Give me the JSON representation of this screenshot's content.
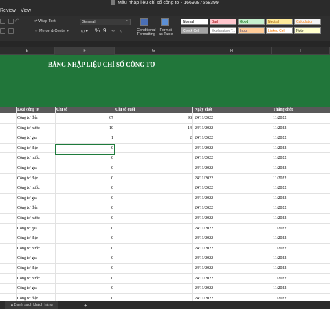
{
  "window": {
    "title": "Mẫu nhập liệu chỉ số công tơ - 1669287558399"
  },
  "menu": {
    "items": [
      "Review",
      "View"
    ]
  },
  "ribbon": {
    "wrap_text": "Wrap Text",
    "merge_center": "Merge & Center",
    "number_format": "General",
    "percent": "%",
    "comma": "9",
    "conditional_formatting": [
      "Conditional",
      "Formatting"
    ],
    "format_as_table": [
      "Format",
      "as Table"
    ],
    "styles": [
      {
        "label": "Normal",
        "bg": "#ffffff",
        "fg": "#000000"
      },
      {
        "label": "Bad",
        "bg": "#ffc7ce",
        "fg": "#9c0006"
      },
      {
        "label": "Good",
        "bg": "#c6efce",
        "fg": "#006100"
      },
      {
        "label": "Neutral",
        "bg": "#ffeb9c",
        "fg": "#9c5700"
      },
      {
        "label": "Calculation",
        "bg": "#f2f2f2",
        "fg": "#fa7d00"
      },
      {
        "label": "Check Cell",
        "bg": "#a5a5a5",
        "fg": "#ffffff"
      },
      {
        "label": "Explanatory T...",
        "bg": "#ffffff",
        "fg": "#7f7f7f"
      },
      {
        "label": "Input",
        "bg": "#ffcc99",
        "fg": "#3f3f76"
      },
      {
        "label": "Linked Cell",
        "bg": "#ffffff",
        "fg": "#fa7d00"
      },
      {
        "label": "Note",
        "bg": "#ffffcc",
        "fg": "#000000"
      }
    ]
  },
  "columns": [
    "E",
    "F",
    "G",
    "H",
    "I"
  ],
  "banner": {
    "title": "BẢNG NHẬP LIỆU CHỈ SỐ CÔNG TƠ"
  },
  "table": {
    "headers": [
      "Loại công tơ",
      "Chỉ số",
      "Chỉ số cuối",
      "Ngày chốt",
      "Tháng chốt"
    ],
    "rows": [
      [
        "Công tơ điện",
        "67",
        "98",
        "24/11/2022",
        "11/2022"
      ],
      [
        "Công tơ nước",
        "10",
        "14",
        "24/11/2022",
        "11/2022"
      ],
      [
        "Công tơ gas",
        "1",
        "2",
        "24/11/2022",
        "11/2022"
      ],
      [
        "Công tơ điện",
        "0",
        "",
        "24/11/2022",
        "11/2022"
      ],
      [
        "Công tơ nước",
        "0",
        "",
        "24/11/2022",
        "11/2022"
      ],
      [
        "Công tơ gas",
        "0",
        "",
        "24/11/2022",
        "11/2022"
      ],
      [
        "Công tơ điện",
        "0",
        "",
        "24/11/2022",
        "11/2022"
      ],
      [
        "Công tơ nước",
        "0",
        "",
        "24/11/2022",
        "11/2022"
      ],
      [
        "Công tơ gas",
        "0",
        "",
        "24/11/2022",
        "11/2022"
      ],
      [
        "Công tơ điện",
        "0",
        "",
        "24/11/2022",
        "11/2022"
      ],
      [
        "Công tơ nước",
        "0",
        "",
        "24/11/2022",
        "11/2022"
      ],
      [
        "Công tơ gas",
        "0",
        "",
        "24/11/2022",
        "11/2022"
      ],
      [
        "Công tơ điện",
        "0",
        "",
        "24/11/2022",
        "11/2022"
      ],
      [
        "Công tơ nước",
        "0",
        "",
        "24/11/2022",
        "11/2022"
      ],
      [
        "Công tơ gas",
        "0",
        "",
        "24/11/2022",
        "11/2022"
      ],
      [
        "Công tơ điện",
        "0",
        "",
        "24/11/2022",
        "11/2022"
      ],
      [
        "Công tơ nước",
        "0",
        "",
        "24/11/2022",
        "11/2022"
      ],
      [
        "Công tơ gas",
        "0",
        "",
        "24/11/2022",
        "11/2022"
      ],
      [
        "Công tơ điện",
        "0",
        "",
        "24/11/2022",
        "11/2022"
      ],
      [
        "Công tơ nước",
        "0",
        "",
        "24/11/2022",
        "11/2022"
      ]
    ]
  },
  "sheet_tabs": {
    "active": "Danh sách khách hàng",
    "add": "+"
  }
}
